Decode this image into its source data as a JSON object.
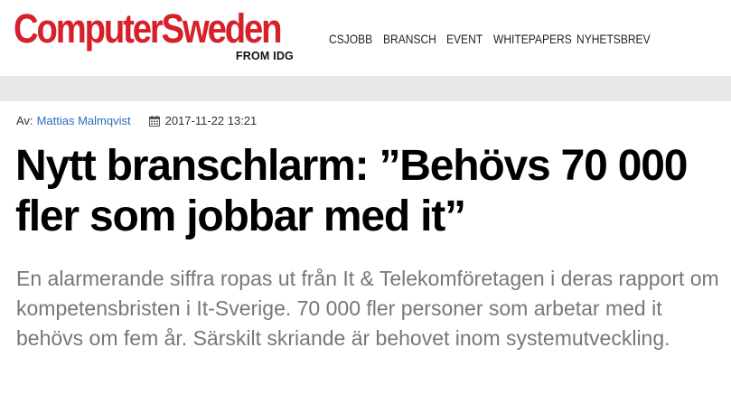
{
  "brand": {
    "name": "ComputerSweden",
    "subline": "FROM IDG",
    "color": "#d6202a"
  },
  "nav": {
    "items": [
      {
        "label": "CSJOBB"
      },
      {
        "label": "BRANSCH"
      },
      {
        "label": "EVENT"
      },
      {
        "label": "WHITEPAPERS"
      },
      {
        "label": "NYHETSBREV"
      }
    ]
  },
  "article": {
    "author_prefix": "Av:",
    "author": "Mattias Malmqvist",
    "date_icon": "calendar-icon",
    "date": "2017-11-22 13:21",
    "headline": "Nytt branschlarm: ”Behövs 70 000 fler som jobbar med it”",
    "ingress": "En alarmerande siffra ropas ut från It & Telekomföretagen i deras rapport om kompetensbristen i It-Sverige. 70 000 fler personer som arbetar med it behövs om fem år. Särskilt skriande är behovet inom systemutveckling.",
    "link_color": "#2a6ebb"
  }
}
